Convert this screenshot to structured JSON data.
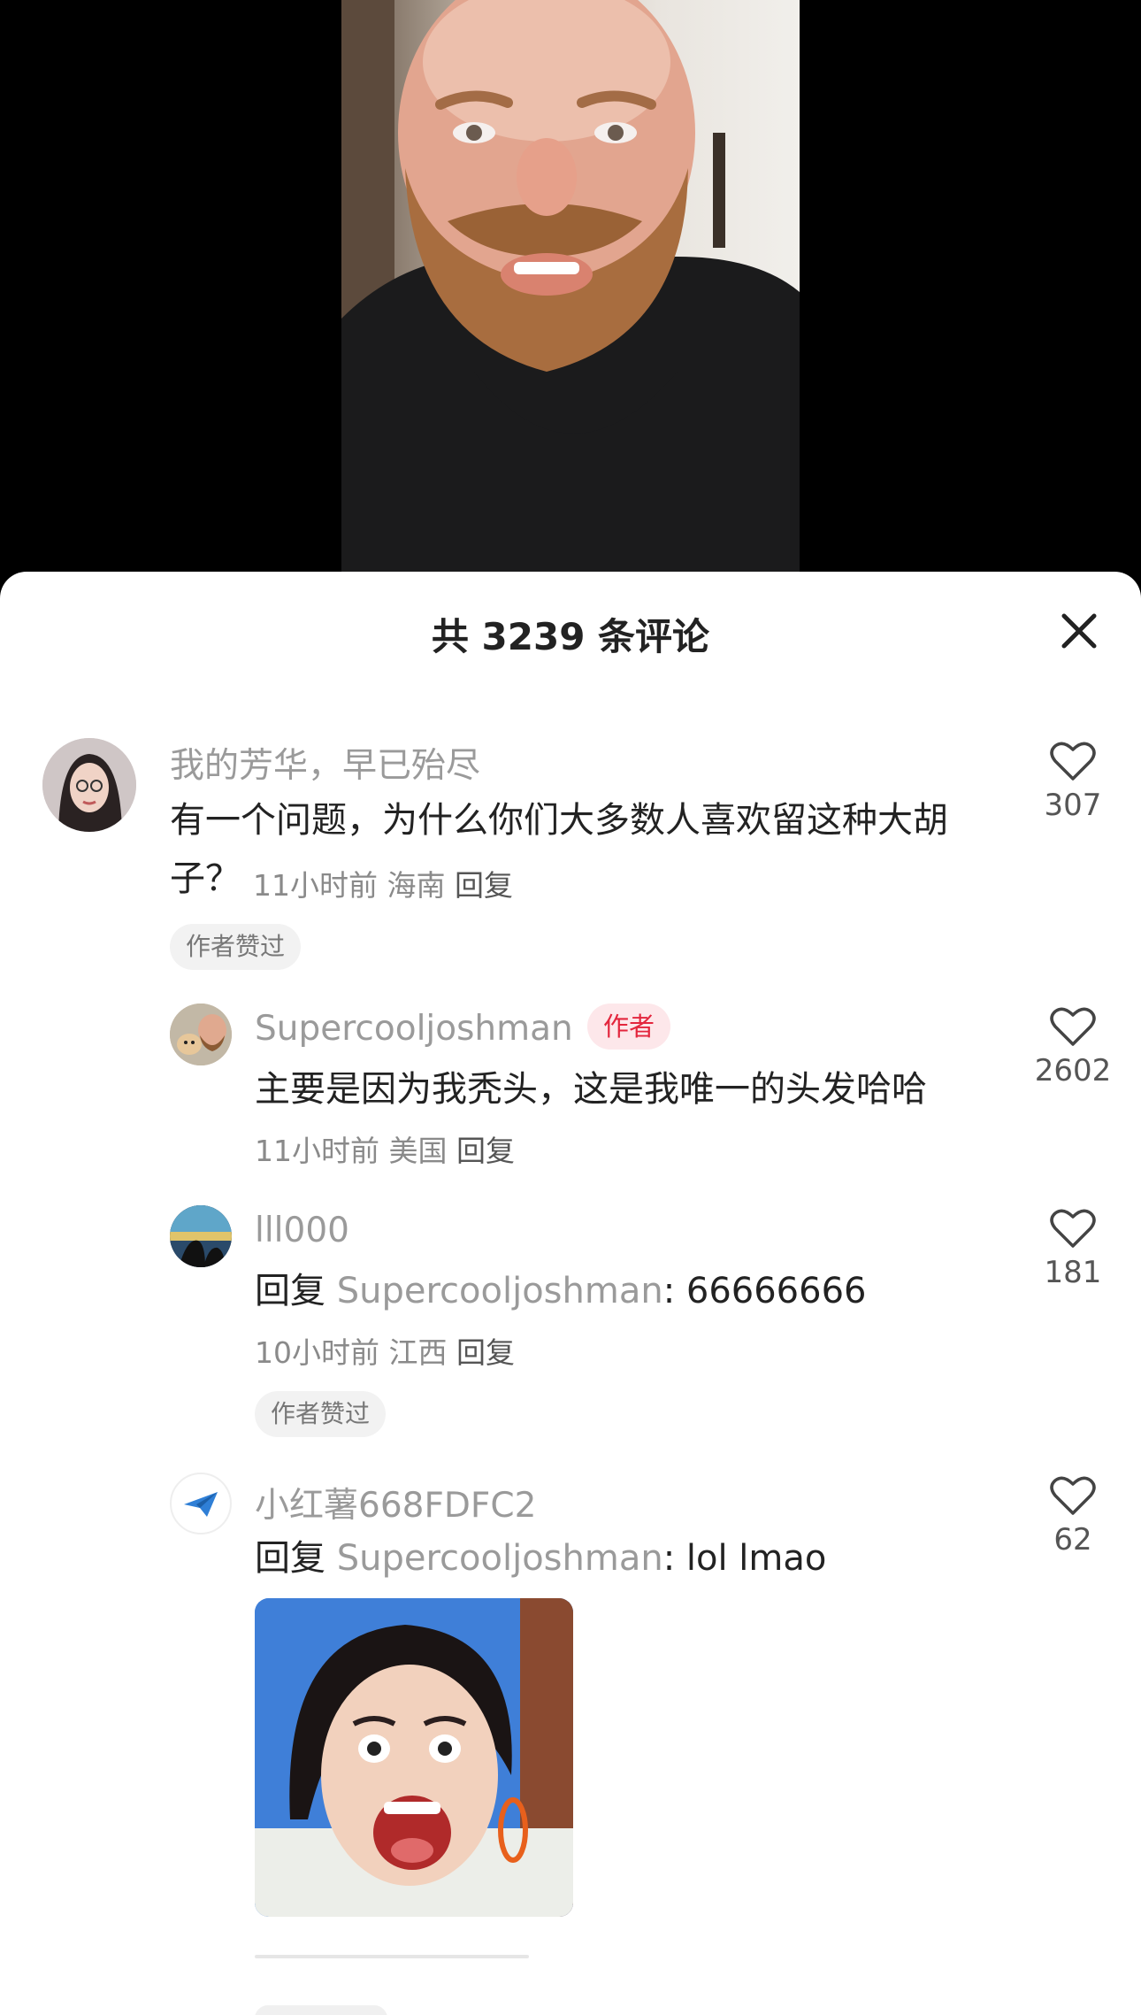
{
  "sheet": {
    "title": "共 3239 条评论"
  },
  "comments": [
    {
      "username": "我的芳华，早已殆尽",
      "text": "有一个问题，为什么你们大多数人喜欢留这种大胡子？",
      "time": "11小时前",
      "location": "海南",
      "reply_label": "回复",
      "likes": "307",
      "tag": "作者赞过"
    },
    {
      "username": "Supercooljoshman",
      "badge": "作者",
      "text": "主要是因为我秃头，这是我唯一的头发哈哈",
      "time": "11小时前",
      "location": "美国",
      "reply_label": "回复",
      "likes": "2602"
    },
    {
      "username": "lll000",
      "reply_prefix": "回复 ",
      "reply_target": "Supercooljoshman",
      "text": ": 66666666",
      "time": "10小时前",
      "location": "江西",
      "reply_label": "回复",
      "likes": "181",
      "tag": "作者赞过"
    },
    {
      "username": "小红薯668FDFC2",
      "reply_prefix": "回复 ",
      "reply_target": "Supercooljoshman",
      "text": ": lol lmao",
      "likes": "62"
    }
  ],
  "colors": {
    "author_badge_bg": "#fde7ea",
    "author_badge_text": "#e3263d",
    "username": "#9a9a9a",
    "text": "#222222"
  },
  "icons": [
    "close-icon",
    "heart-outline-icon",
    "paper-plane-icon"
  ]
}
